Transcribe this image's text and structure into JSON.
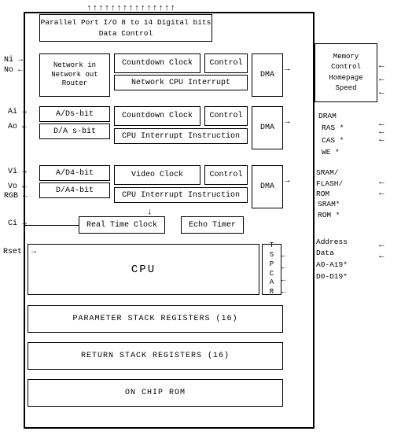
{
  "diagram": {
    "top_arrows": "↑↑↑↑↑↑↑↑↑↑↑↑↑↑↑",
    "parallel_port": {
      "line1": "Parallel Port I/O   8 to 14 Digital bits",
      "line2": "Data        Control"
    },
    "row1": {
      "network": "Network in\nNetwork out\nRouter",
      "countdown": "Countdown Clock",
      "control": "Control",
      "dma": "DMA",
      "interrupt": "Network CPU Interrupt"
    },
    "row2": {
      "ad8": "A/Ds-bit",
      "da8": "D/A s-bit",
      "countdown": "Countdown Clock",
      "control": "Control",
      "dma": "DMA",
      "interrupt": "CPU Interrupt Instruction"
    },
    "row3": {
      "ad4": "A/D4-bit",
      "da4": "D/A4-bit",
      "video": "Video Clock",
      "control": "Control",
      "dma": "DMA",
      "interrupt": "CPU Interrupt Instruction"
    },
    "row4": {
      "rtc": "Real Time Clock",
      "echo": "Echo Timer"
    },
    "cpu": {
      "label": "CPU",
      "tscar": "T\nS\nP\nC\nA\nR"
    },
    "param_stack": "PARAMETER STACK REGISTERS (16)",
    "return_stack": "RETURN STACK REGISTERS (16)",
    "rom": "ON CHIP ROM",
    "right": {
      "memory_control": "Memory\nControl\nHomepage\nSpeed",
      "dram_label": "DRAM",
      "dram_ras": "RAS *",
      "dram_cas": "CAS *",
      "dram_we": "WE  *",
      "sram_label": "SRAM/\nFLASH/\nROM",
      "sram_star": "SRAM*",
      "rom_star": "ROM *",
      "address_label": "Address\nData",
      "a0": "A0-A19*",
      "d0": "D0-D19*"
    },
    "labels": {
      "ni": "Ni",
      "no": "No",
      "ai": "Ai",
      "ao": "Ao",
      "vi": "Vi",
      "vo": "Vo",
      "rgb": "RGB",
      "ci": "Ci",
      "rset": "Rset."
    },
    "arrows": {
      "ni_arrow": "→",
      "no_arrow": "←",
      "ai_arrow": "→",
      "ao_arrow": "←",
      "vi_arrow": "→",
      "vo_arrow": "←",
      "ci_arrow": "→",
      "rset_arrow": "→",
      "dma1_arrow": "→",
      "dma2_arrow": "→",
      "dma3_arrow": "→"
    }
  }
}
